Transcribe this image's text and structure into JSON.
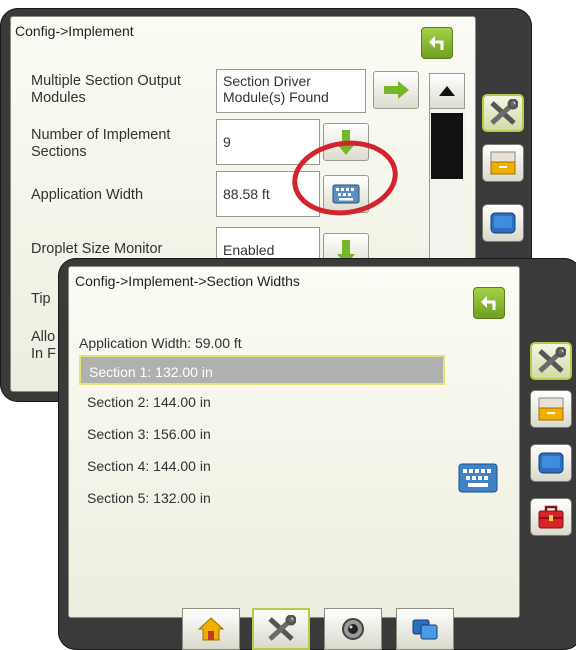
{
  "back_screen": {
    "title": "Config->Implement",
    "rows": [
      {
        "label": "Multiple Section Output Modules",
        "value": "Section Driver Module(s) Found"
      },
      {
        "label": "Number of Implement Sections",
        "value": "9"
      },
      {
        "label": "Application Width",
        "value": "88.58 ft"
      },
      {
        "label": "Droplet Size Monitor",
        "value": "Enabled"
      },
      {
        "label": "Tip"
      },
      {
        "label": "Allo In F"
      }
    ]
  },
  "front_screen": {
    "title": "Config->Implement->Section Widths",
    "application_width": "Application Width: 59.00 ft",
    "sections": [
      "Section 1: 132.00 in",
      "Section 2: 144.00 in",
      "Section 3: 156.00 in",
      "Section 4: 144.00 in",
      "Section 5: 132.00 in"
    ],
    "selected_index": 0
  },
  "colors": {
    "highlight_ring": "#d2242c",
    "green_arrow": "#76b62a",
    "selection_border": "#e3e373"
  },
  "icons": {
    "back": "back-arrow-icon",
    "keyboard": "keyboard-icon",
    "tools": "tools-icon",
    "storage": "storage-drawer-icon",
    "console": "console-monitor-icon",
    "toolbox": "toolbox-icon",
    "home": "home-icon",
    "camera": "camera-icon",
    "layers": "layers-icon"
  }
}
